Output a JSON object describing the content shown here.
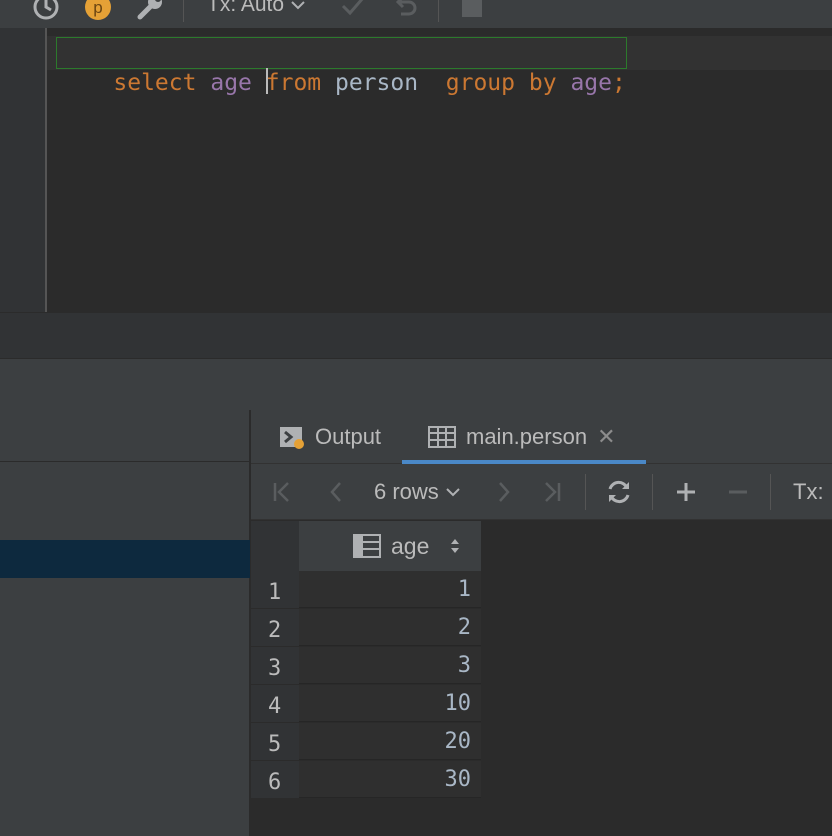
{
  "toolbar": {
    "tx_label": "Tx: Auto",
    "icons": [
      "history-icon",
      "profile-badge-icon",
      "wrench-icon",
      "chevron-down-icon",
      "commit-icon",
      "rollback-icon",
      "stop-icon"
    ],
    "profile_badge_letter": "p"
  },
  "editor": {
    "tokens": [
      {
        "text": "select",
        "kind": "keyword"
      },
      {
        "text": " ",
        "kind": "plain"
      },
      {
        "text": "age",
        "kind": "column"
      },
      {
        "text": " ",
        "kind": "plain"
      },
      {
        "text": "from",
        "kind": "keyword"
      },
      {
        "text": " person  ",
        "kind": "plain"
      },
      {
        "text": "group",
        "kind": "keyword"
      },
      {
        "text": " ",
        "kind": "plain"
      },
      {
        "text": "by",
        "kind": "keyword"
      },
      {
        "text": " ",
        "kind": "plain"
      },
      {
        "text": "age",
        "kind": "column"
      },
      {
        "text": ";",
        "kind": "keyword"
      }
    ],
    "colors": {
      "keyword": "#cc7832",
      "column": "#9876aa",
      "plain": "#a9b7c6"
    }
  },
  "results": {
    "tabs": [
      {
        "label": "Output",
        "icon": "console-icon"
      },
      {
        "label": "main.person",
        "icon": "table-icon",
        "active": true,
        "closable": true
      }
    ],
    "grid_toolbar": {
      "rows_label": "6 rows",
      "tx_label": "Tx:"
    },
    "columns": [
      {
        "name": "age"
      }
    ],
    "rows": [
      {
        "num": "1",
        "age": "1"
      },
      {
        "num": "2",
        "age": "2"
      },
      {
        "num": "3",
        "age": "3"
      },
      {
        "num": "4",
        "age": "10"
      },
      {
        "num": "5",
        "age": "20"
      },
      {
        "num": "6",
        "age": "30"
      }
    ]
  },
  "theme": {
    "accent": "#4a88c7",
    "selection": "#0d293e",
    "badge": "#e5a136"
  }
}
